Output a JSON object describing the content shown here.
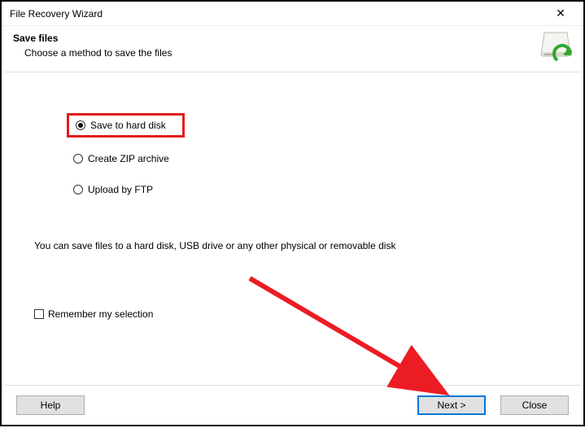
{
  "window": {
    "title": "File Recovery Wizard"
  },
  "header": {
    "title": "Save files",
    "subtitle": "Choose a method to save the files"
  },
  "options": {
    "save_disk": "Save to hard disk",
    "zip": "Create ZIP archive",
    "ftp": "Upload by FTP"
  },
  "hint": "You can save files to a hard disk, USB drive or any other physical or removable disk",
  "remember_label": "Remember my selection",
  "buttons": {
    "help": "Help",
    "next": "Next >",
    "close": "Close"
  },
  "icons": {
    "close": "✕"
  }
}
